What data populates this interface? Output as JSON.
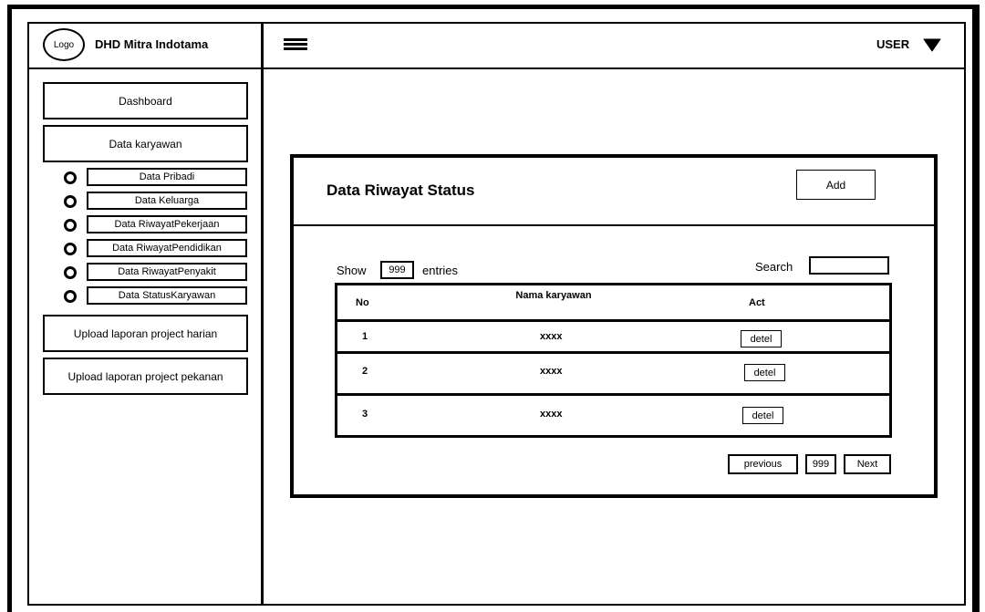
{
  "header": {
    "logo_text": "Logo",
    "brand": "DHD Mitra Indotama",
    "user_label": "USER"
  },
  "sidebar": {
    "items": [
      {
        "label": "Dashboard"
      },
      {
        "label": "Data karyawan"
      }
    ],
    "subitems": [
      {
        "label": "Data Pribadi"
      },
      {
        "label": "Data Keluarga"
      },
      {
        "label": "Data RiwayatPekerjaan"
      },
      {
        "label": "Data RiwayatPendidikan"
      },
      {
        "label": "Data RiwayatPenyakit"
      },
      {
        "label": "Data StatusKaryawan"
      }
    ],
    "bottom_items": [
      {
        "label": "Upload laporan project harian"
      },
      {
        "label": "Upload laporan project pekanan"
      }
    ]
  },
  "main": {
    "title": "Data Riwayat  Status",
    "add_label": "Add",
    "show_label": "Show",
    "show_value": "999",
    "entries_label": "entries",
    "search_label": "Search",
    "search_value": "",
    "table": {
      "headers": [
        "No",
        "Nama karyawan",
        "Act"
      ],
      "rows": [
        {
          "no": "1",
          "name": "xxxx",
          "action": "detel"
        },
        {
          "no": "2",
          "name": "xxxx",
          "action": "detel"
        },
        {
          "no": "3",
          "name": "xxxx",
          "action": "detel"
        }
      ]
    },
    "pagination": {
      "previous": "previous",
      "page": "999",
      "next": "Next"
    }
  }
}
